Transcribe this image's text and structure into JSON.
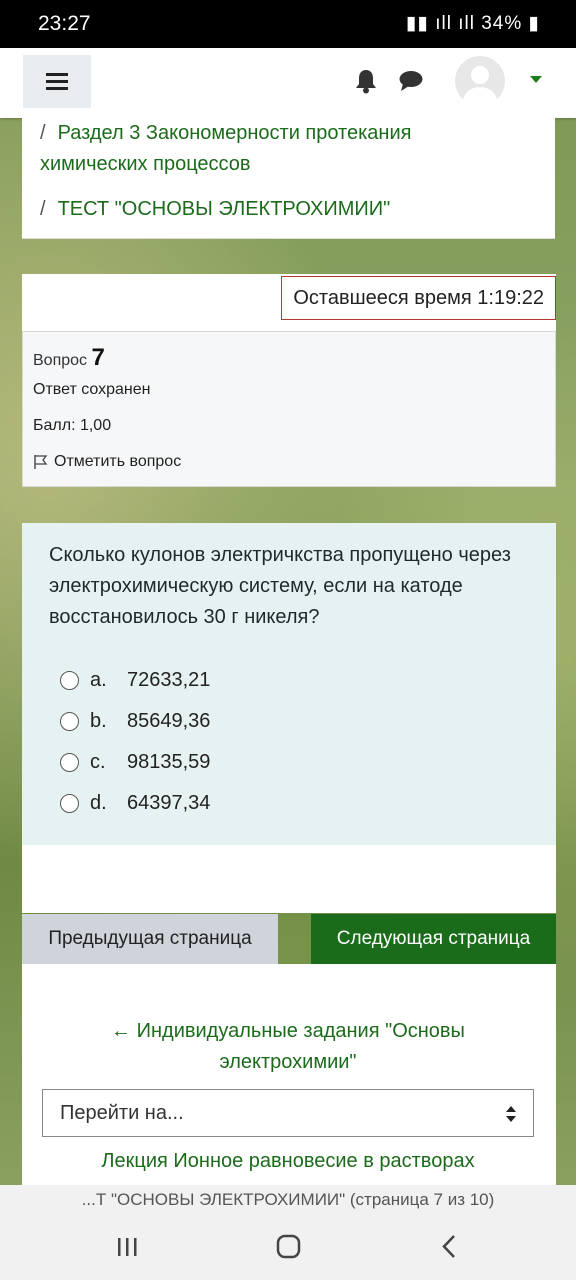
{
  "status_bar": {
    "time": "23:27",
    "battery": "34%"
  },
  "header": {
    "icons": [
      "menu-icon",
      "bell-icon",
      "chat-icon",
      "avatar",
      "chevron-down-icon"
    ]
  },
  "breadcrumb": {
    "items": [
      {
        "sep": "/",
        "label_line1": "Раздел 3 Закономерности протекания",
        "label_line2": "химических процессов"
      },
      {
        "sep": "/",
        "label_line1": "ТЕСТ \"ОСНОВЫ ЭЛЕКТРОХИМИИ\""
      }
    ]
  },
  "timer": {
    "text": "Оставшееся время 1:19:22"
  },
  "question_info": {
    "label": "Вопрос",
    "number": "7",
    "state": "Ответ сохранен",
    "grade": "Балл: 1,00",
    "flag_label": "Отметить вопрос"
  },
  "question": {
    "text": "Сколько кулонов электричкства пропущено через электрохимическую систему, если на катоде восстановилось 30 г никеля?",
    "answers": [
      {
        "letter": "a.",
        "value": "72633,21"
      },
      {
        "letter": "b.",
        "value": "85649,36"
      },
      {
        "letter": "c.",
        "value": "98135,59"
      },
      {
        "letter": "d.",
        "value": "64397,34"
      }
    ]
  },
  "navigation": {
    "prev_button": "Предыдущая страница",
    "next_button": "Следующая страница",
    "prev_activity_line1": "← Индивидуальные задания \"Основы",
    "prev_activity_line2": "электрохимии\"",
    "jump_placeholder": "Перейти на...",
    "next_activity": "Лекция Ионное равновесие в растворах"
  },
  "browser": {
    "title": "...Т \"ОСНОВЫ ЭЛЕКТРОХИМИИ\" (страница 7 из 10)"
  },
  "colors": {
    "link_green": "#1b6b1b",
    "next_button_bg": "#1a6b1a",
    "question_bg": "#e6f1f2",
    "timer_border": "#b3392f"
  }
}
